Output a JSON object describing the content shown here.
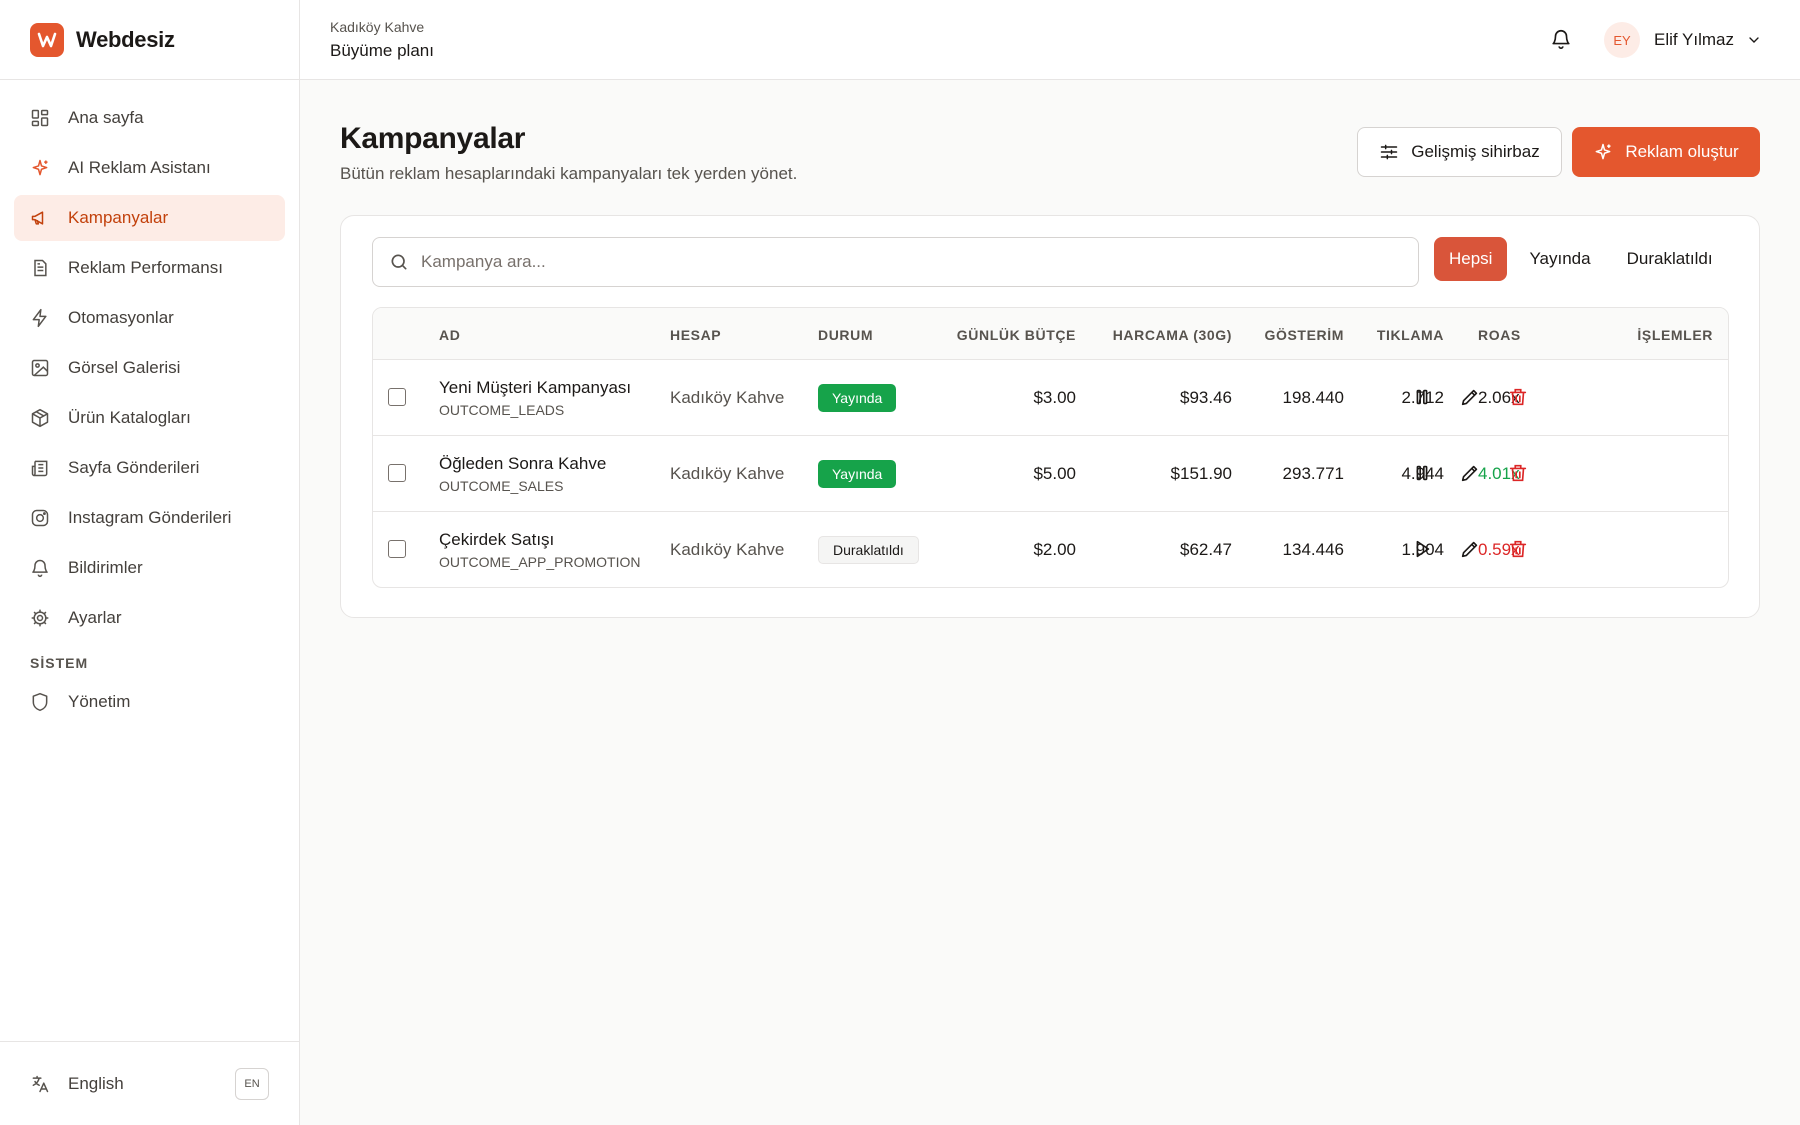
{
  "brand": {
    "name": "Webdesiz",
    "accent": "#e4572e"
  },
  "sidebar": {
    "items": [
      {
        "label": "Ana sayfa",
        "icon": "dashboard-icon"
      },
      {
        "label": "AI Reklam Asistanı",
        "icon": "sparkles-icon"
      },
      {
        "label": "Kampanyalar",
        "icon": "megaphone-icon",
        "active": true
      },
      {
        "label": "Reklam Performansı",
        "icon": "report-icon"
      },
      {
        "label": "Otomasyonlar",
        "icon": "lightning-icon"
      },
      {
        "label": "Görsel Galerisi",
        "icon": "image-icon"
      },
      {
        "label": "Ürün Katalogları",
        "icon": "box-icon"
      },
      {
        "label": "Sayfa Gönderileri",
        "icon": "newspaper-icon"
      },
      {
        "label": "Instagram Gönderileri",
        "icon": "instagram-icon"
      },
      {
        "label": "Bildirimler",
        "icon": "bell-icon"
      },
      {
        "label": "Ayarlar",
        "icon": "gear-icon"
      }
    ],
    "section_label": "SİSTEM",
    "system_items": [
      {
        "label": "Yönetim",
        "icon": "shield-icon"
      }
    ],
    "footer": {
      "language": "English",
      "code": "EN"
    }
  },
  "header": {
    "account": "Kadıköy Kahve",
    "plan": "Büyüme planı",
    "user": {
      "initials": "EY",
      "name": "Elif Yılmaz"
    }
  },
  "page": {
    "title": "Kampanyalar",
    "subtitle": "Bütün reklam hesaplarındaki kampanyaları tek yerden yönet.",
    "advanced_button": "Gelişmiş sihirbaz",
    "create_button": "Reklam oluştur"
  },
  "search": {
    "placeholder": "Kampanya ara...",
    "value": ""
  },
  "filters": [
    "Hepsi",
    "Yayında",
    "Duraklatıldı"
  ],
  "table": {
    "columns": [
      "AD",
      "HESAP",
      "DURUM",
      "GÜNLÜK BÜTÇE",
      "HARCAMA (30G)",
      "GÖSTERİM",
      "TIKLAMA",
      "ROAS",
      "İŞLEMLER"
    ],
    "rows": [
      {
        "name": "Yeni Müşteri Kampanyası",
        "objective": "OUTCOME_LEADS",
        "account": "Kadıköy Kahve",
        "status": "Yayında",
        "status_type": "live",
        "budget": "$3.00",
        "spend": "$93.46",
        "impressions": "198.440",
        "clicks": "2.712",
        "roas": "2.06x",
        "roas_color": "#1c1917",
        "toggle_icon": "pause-icon"
      },
      {
        "name": "Öğleden Sonra Kahve",
        "objective": "OUTCOME_SALES",
        "account": "Kadıköy Kahve",
        "status": "Yayında",
        "status_type": "live",
        "budget": "$5.00",
        "spend": "$151.90",
        "impressions": "293.771",
        "clicks": "4.944",
        "roas": "4.01x",
        "roas_color": "#16a34a",
        "toggle_icon": "pause-icon"
      },
      {
        "name": "Çekirdek Satışı",
        "objective": "OUTCOME_APP_PROMOTION",
        "account": "Kadıköy Kahve",
        "status": "Duraklatıldı",
        "status_type": "paused",
        "budget": "$2.00",
        "spend": "$62.47",
        "impressions": "134.446",
        "clicks": "1.904",
        "roas": "0.59x",
        "roas_color": "#dc2626",
        "toggle_icon": "play-icon"
      }
    ]
  }
}
